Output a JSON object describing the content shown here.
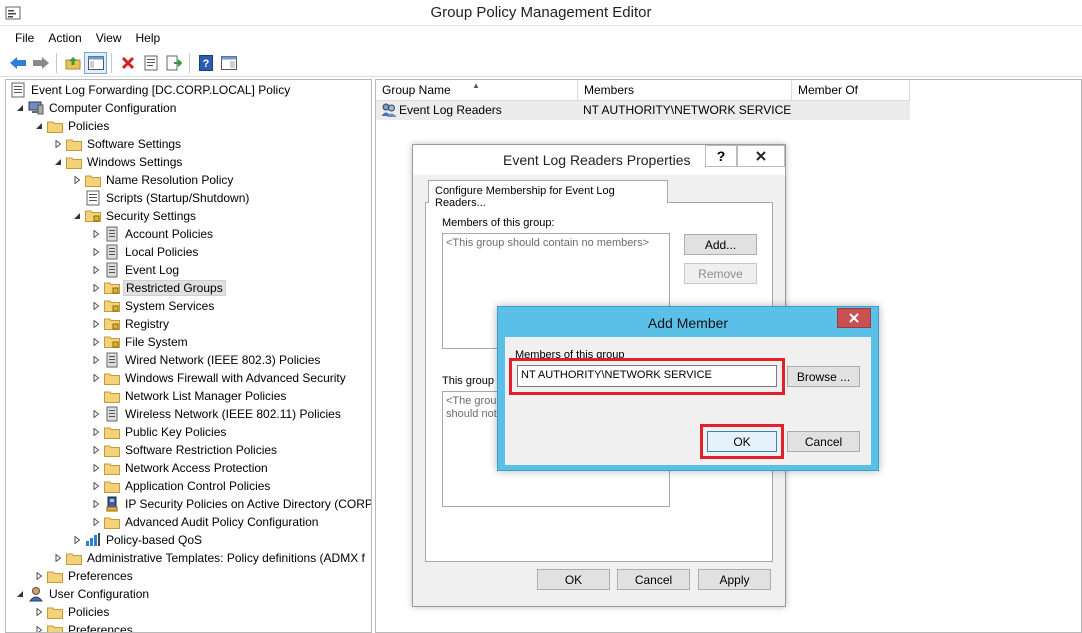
{
  "window": {
    "title": "Group Policy Management Editor"
  },
  "menu": {
    "file": "File",
    "action": "Action",
    "view": "View",
    "help": "Help"
  },
  "toolbar": {
    "buttons": [
      "back-icon",
      "forward-icon",
      "up-folder-icon",
      "show-hide-tree-icon",
      "delete-icon",
      "properties-icon",
      "export-list-icon",
      "help-icon",
      "view-icon"
    ]
  },
  "tree": {
    "root": "Event Log Forwarding [DC.CORP.LOCAL] Policy",
    "computer_configuration": "Computer Configuration",
    "policies": "Policies",
    "software_settings": "Software Settings",
    "windows_settings": "Windows Settings",
    "name_resolution_policy": "Name Resolution Policy",
    "scripts": "Scripts (Startup/Shutdown)",
    "security_settings": "Security Settings",
    "account_policies": "Account Policies",
    "local_policies": "Local Policies",
    "event_log": "Event Log",
    "restricted_groups": "Restricted Groups",
    "system_services": "System Services",
    "registry": "Registry",
    "file_system": "File System",
    "wired_network": "Wired Network (IEEE 802.3) Policies",
    "windows_firewall": "Windows Firewall with Advanced Security",
    "network_list_manager": "Network List Manager Policies",
    "wireless_network": "Wireless Network (IEEE 802.11) Policies",
    "public_key_policies": "Public Key Policies",
    "software_restriction": "Software Restriction Policies",
    "network_access_protection": "Network Access Protection",
    "application_control": "Application Control Policies",
    "ip_security": "IP Security Policies on Active Directory (CORP.",
    "advanced_audit": "Advanced Audit Policy Configuration",
    "policy_based_qos": "Policy-based QoS",
    "admin_templates": "Administrative Templates: Policy definitions (ADMX f",
    "preferences": "Preferences",
    "user_configuration": "User Configuration",
    "user_policies": "Policies",
    "user_preferences": "Preferences"
  },
  "list": {
    "columns": {
      "group_name": "Group Name",
      "members": "Members",
      "member_of": "Member Of"
    },
    "rows": [
      {
        "group_name": "Event Log Readers",
        "members": "NT AUTHORITY\\NETWORK SERVICE",
        "member_of": ""
      }
    ]
  },
  "properties_dialog": {
    "title": "Event Log Readers Properties",
    "help_glyph": "?",
    "close_glyph": "✕",
    "tab": "Configure Membership for Event Log Readers...",
    "members_label": "Members of this group:",
    "members_placeholder": "<This group should contain no members>",
    "add_button": "Add...",
    "remove_button": "Remove",
    "member_of_label": "This group is",
    "member_of_placeholder_1": "<The group",
    "member_of_placeholder_2": "should not l",
    "ok": "OK",
    "cancel": "Cancel",
    "apply": "Apply"
  },
  "add_member_dialog": {
    "title": "Add Member",
    "members_label": "Members of this group",
    "member_value": "NT AUTHORITY\\NETWORK SERVICE",
    "browse": "Browse ...",
    "ok": "OK",
    "cancel": "Cancel"
  },
  "colors": {
    "add_member_titlebar": "#5bc0e8",
    "highlight": "#e0202a",
    "close_button": "#c75050"
  }
}
